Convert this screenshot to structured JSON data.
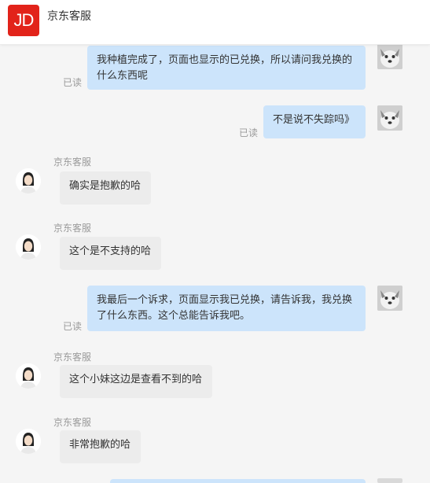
{
  "header": {
    "logo_text": "JD",
    "title": "京东客服"
  },
  "messages": [
    {
      "from": "user",
      "text": "我种植完成了，页面也显示的已兑换，所以请问我兑换的什么东西呢",
      "read": "已读"
    },
    {
      "from": "user",
      "text": "不是说不失踪吗》",
      "read": "已读"
    },
    {
      "from": "agent",
      "sender": "京东客服",
      "text": "确实是抱歉的哈"
    },
    {
      "from": "agent",
      "sender": "京东客服",
      "text": "这个是不支持的哈"
    },
    {
      "from": "user",
      "text": "我最后一个诉求，页面显示我已兑换，请告诉我，我兑换了什么东西。这个总能告诉我吧。",
      "read": "已读"
    },
    {
      "from": "agent",
      "sender": "京东客服",
      "text": "这个小妹这边是查看不到的哈"
    },
    {
      "from": "agent",
      "sender": "京东客服",
      "text": "非常抱歉的哈"
    }
  ],
  "colors": {
    "brand": "#e2231a",
    "user_bubble": "#cce4fb",
    "agent_bubble": "#ececec"
  },
  "icons": {
    "user_avatar": "husky-dog-avatar",
    "agent_avatar": "customer-service-agent-avatar"
  }
}
